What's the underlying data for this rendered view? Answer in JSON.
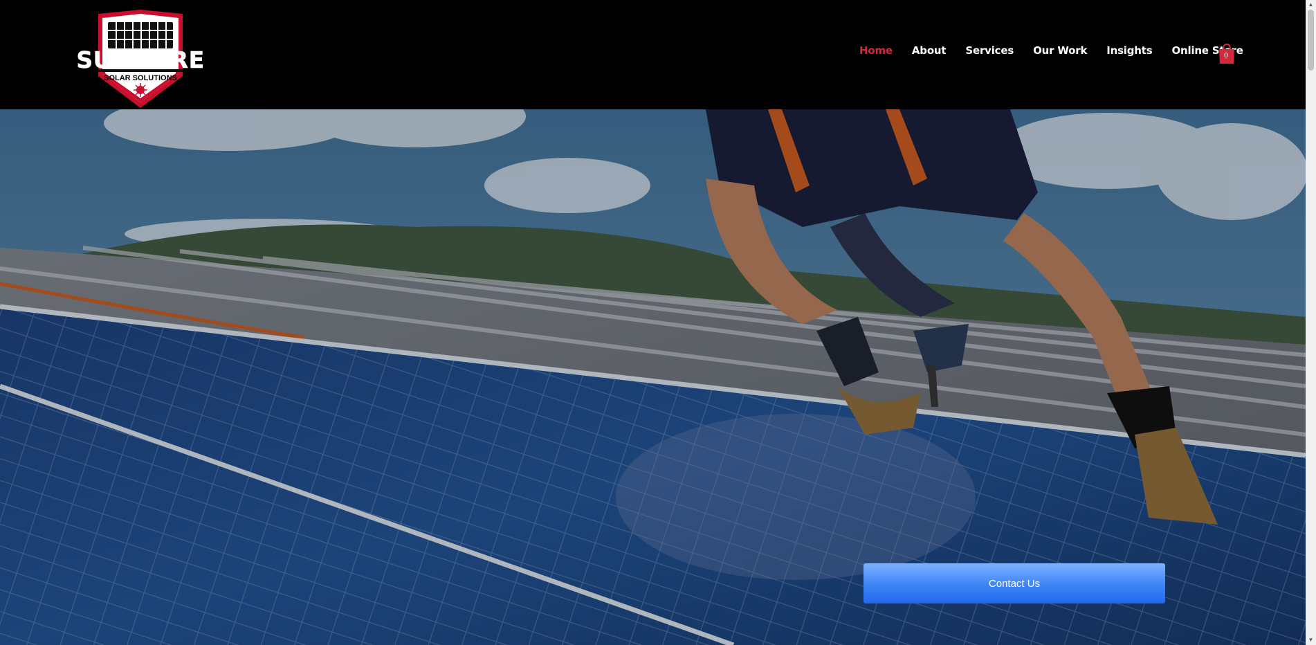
{
  "logo": {
    "wordmark": "SUREFIRE",
    "tagline": "SOLAR SOLUTIONS"
  },
  "nav": {
    "items": [
      {
        "label": "Home",
        "active": true
      },
      {
        "label": "About"
      },
      {
        "label": "Services"
      },
      {
        "label": "Our Work"
      },
      {
        "label": "Insights"
      },
      {
        "label": "Online Store"
      }
    ],
    "cart_count": "0"
  },
  "hero": {
    "cta_label": "Contact Us"
  },
  "colors": {
    "header_bg": "#000000",
    "accent_red": "#d22a3c",
    "cta_blue": "#3c84f7"
  }
}
